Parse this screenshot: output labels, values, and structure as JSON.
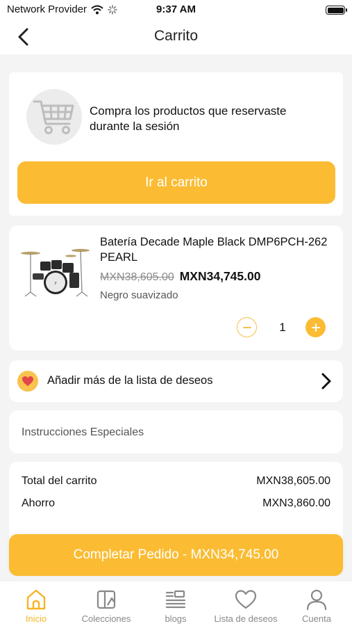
{
  "status_bar": {
    "carrier": "Network Provider",
    "time": "9:37 AM",
    "icons": [
      "wifi-icon",
      "loading-icon",
      "battery-icon"
    ]
  },
  "nav": {
    "title": "Carrito",
    "back_icon": "chevron-left-icon"
  },
  "session_card": {
    "icon": "cart-icon",
    "message": "Compra los productos que reservaste durante la sesión",
    "button_label": "Ir al carrito"
  },
  "product": {
    "image": "drum-kit-image",
    "name": "Batería Decade Maple Black DMP6PCH-262 PEARL",
    "old_price": "MXN38,605.00",
    "price": "MXN34,745.00",
    "variant": "Negro suavizado",
    "quantity": "1"
  },
  "wishlist_row": {
    "icon": "heart-icon",
    "label": "Añadir más de la lista de deseos"
  },
  "instructions": {
    "label": "Instrucciones Especiales"
  },
  "totals": {
    "rows": [
      {
        "label": "Total del carrito",
        "value": "MXN38,605.00"
      },
      {
        "label": "Ahorro",
        "value": "MXN3,860.00"
      }
    ]
  },
  "complete_button": {
    "label": "Completar Pedido - MXN34,745.00"
  },
  "tabbar": {
    "tabs": [
      {
        "label": "Inicio",
        "icon": "home-icon",
        "active": true
      },
      {
        "label": "Colecciones",
        "icon": "collections-icon",
        "active": false
      },
      {
        "label": "blogs",
        "icon": "blogs-icon",
        "active": false
      },
      {
        "label": "Lista de deseos",
        "icon": "heart-icon",
        "active": false
      },
      {
        "label": "Cuenta",
        "icon": "user-icon",
        "active": false
      }
    ]
  },
  "colors": {
    "accent": "#fbbc33",
    "active_tab": "#f5b523",
    "background": "#f4f4f4"
  }
}
